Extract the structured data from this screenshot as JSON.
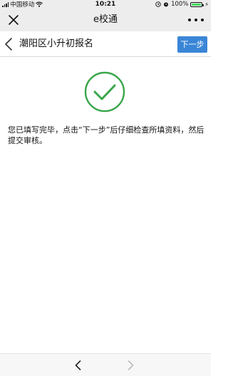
{
  "status_bar": {
    "carrier": "中国移动",
    "time": "10:21",
    "battery": "100%"
  },
  "app": {
    "title": "e校通"
  },
  "header": {
    "title": "潮阳区小升初报名",
    "next_label": "下一步"
  },
  "main": {
    "message": "您已填写完毕，点击“下一步”后仔细检查所填资料，然后提交审核。"
  },
  "icons": {
    "status": [
      "signal-icon",
      "wifi-icon",
      "location-icon",
      "alarm-icon",
      "battery-icon",
      "charging-icon"
    ],
    "titlebar": [
      "close-icon",
      "more-icon"
    ],
    "header": [
      "chevron-left-icon"
    ],
    "content": [
      "success-check-icon"
    ],
    "toolbar": [
      "back-arrow-icon",
      "forward-arrow-icon"
    ]
  },
  "colors": {
    "accent_blue": "#3a86d6",
    "success_green": "#3aa64a",
    "battery_green": "#4cd964",
    "bar_gray": "#ededed"
  },
  "states": {
    "forward_enabled": false
  }
}
